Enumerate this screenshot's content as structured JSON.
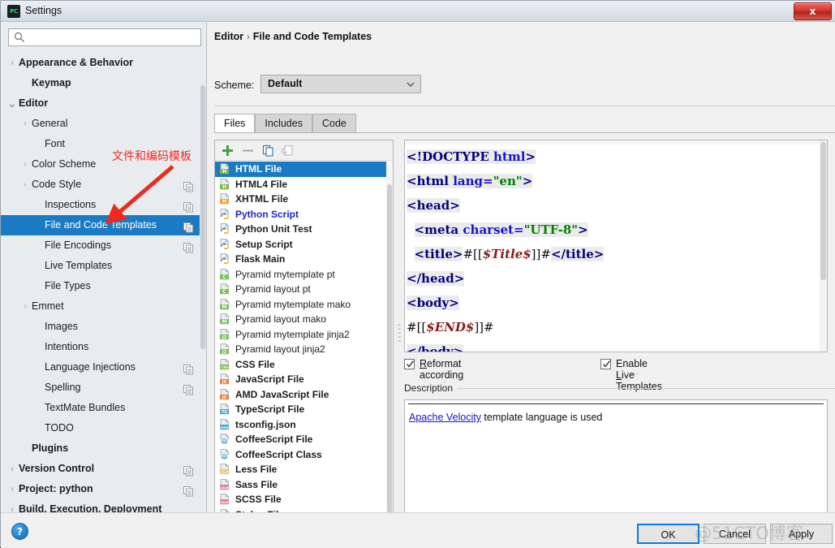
{
  "window": {
    "title": "Settings",
    "app_icon": "pycharm-icon",
    "app_icon_text": "PC",
    "close_label": "x"
  },
  "search": {
    "value": "",
    "placeholder": "",
    "icon": "search-icon"
  },
  "sidebar": {
    "items": [
      {
        "label": "Appearance & Behavior",
        "indent": 0,
        "arrow": "right",
        "bold": true,
        "selected": false,
        "config_icon": false
      },
      {
        "label": "Keymap",
        "indent": 1,
        "arrow": "",
        "bold": true,
        "selected": false,
        "config_icon": false
      },
      {
        "label": "Editor",
        "indent": 0,
        "arrow": "down",
        "bold": true,
        "selected": false,
        "config_icon": false
      },
      {
        "label": "General",
        "indent": 1,
        "arrow": "right",
        "bold": false,
        "selected": false,
        "config_icon": false
      },
      {
        "label": "Font",
        "indent": 2,
        "arrow": "",
        "bold": false,
        "selected": false,
        "config_icon": false
      },
      {
        "label": "Color Scheme",
        "indent": 1,
        "arrow": "right",
        "bold": false,
        "selected": false,
        "config_icon": false
      },
      {
        "label": "Code Style",
        "indent": 1,
        "arrow": "right",
        "bold": false,
        "selected": false,
        "config_icon": true
      },
      {
        "label": "Inspections",
        "indent": 2,
        "arrow": "",
        "bold": false,
        "selected": false,
        "config_icon": true
      },
      {
        "label": "File and Code Templates",
        "indent": 2,
        "arrow": "",
        "bold": false,
        "selected": true,
        "config_icon": true
      },
      {
        "label": "File Encodings",
        "indent": 2,
        "arrow": "",
        "bold": false,
        "selected": false,
        "config_icon": true
      },
      {
        "label": "Live Templates",
        "indent": 2,
        "arrow": "",
        "bold": false,
        "selected": false,
        "config_icon": false
      },
      {
        "label": "File Types",
        "indent": 2,
        "arrow": "",
        "bold": false,
        "selected": false,
        "config_icon": false
      },
      {
        "label": "Emmet",
        "indent": 1,
        "arrow": "right",
        "bold": false,
        "selected": false,
        "config_icon": false
      },
      {
        "label": "Images",
        "indent": 2,
        "arrow": "",
        "bold": false,
        "selected": false,
        "config_icon": false
      },
      {
        "label": "Intentions",
        "indent": 2,
        "arrow": "",
        "bold": false,
        "selected": false,
        "config_icon": false
      },
      {
        "label": "Language Injections",
        "indent": 2,
        "arrow": "",
        "bold": false,
        "selected": false,
        "config_icon": true
      },
      {
        "label": "Spelling",
        "indent": 2,
        "arrow": "",
        "bold": false,
        "selected": false,
        "config_icon": true
      },
      {
        "label": "TextMate Bundles",
        "indent": 2,
        "arrow": "",
        "bold": false,
        "selected": false,
        "config_icon": false
      },
      {
        "label": "TODO",
        "indent": 2,
        "arrow": "",
        "bold": false,
        "selected": false,
        "config_icon": false
      },
      {
        "label": "Plugins",
        "indent": 1,
        "arrow": "",
        "bold": true,
        "selected": false,
        "config_icon": false
      },
      {
        "label": "Version Control",
        "indent": 0,
        "arrow": "right",
        "bold": true,
        "selected": false,
        "config_icon": true
      },
      {
        "label": "Project: python",
        "indent": 0,
        "arrow": "right",
        "bold": true,
        "selected": false,
        "config_icon": true
      },
      {
        "label": "Build, Execution, Deployment",
        "indent": 0,
        "arrow": "right",
        "bold": true,
        "selected": false,
        "config_icon": false
      }
    ]
  },
  "annotation": {
    "text": "文件和编码模板",
    "color": "#ee2a1e"
  },
  "main": {
    "breadcrumb": {
      "parent": "Editor",
      "separator": "›",
      "current": "File and Code Templates"
    },
    "scheme": {
      "label": "Scheme:",
      "value": "Default"
    },
    "tabs": [
      {
        "label": "Files",
        "active": true
      },
      {
        "label": "Includes",
        "active": false
      },
      {
        "label": "Code",
        "active": false
      }
    ],
    "toolbar": [
      {
        "name": "add-template-button",
        "glyph": "plus",
        "enabled": true
      },
      {
        "name": "remove-template-button",
        "glyph": "minus",
        "enabled": false
      },
      {
        "name": "copy-template-button",
        "glyph": "copy",
        "enabled": true
      },
      {
        "name": "reset-template-button",
        "glyph": "reset",
        "enabled": false
      }
    ],
    "templates": [
      {
        "label": "HTML File",
        "icon": "html-file-icon",
        "badge": "H",
        "badge_color": "#7ab648",
        "bold": true,
        "blue": false,
        "selected": true
      },
      {
        "label": "HTML4 File",
        "icon": "html-file-icon",
        "badge": "H",
        "badge_color": "#7ab648",
        "bold": true,
        "blue": false,
        "selected": false
      },
      {
        "label": "XHTML File",
        "icon": "xhtml-file-icon",
        "badge": "H",
        "badge_color": "#f0a030",
        "bold": true,
        "blue": false,
        "selected": false
      },
      {
        "label": "Python Script",
        "icon": "python-file-icon",
        "badge": "PY",
        "badge_color": "#3b77b0",
        "bold": true,
        "blue": true,
        "selected": false
      },
      {
        "label": "Python Unit Test",
        "icon": "python-file-icon",
        "badge": "PY",
        "badge_color": "#3b77b0",
        "bold": true,
        "blue": false,
        "selected": false
      },
      {
        "label": "Setup Script",
        "icon": "python-file-icon",
        "badge": "PY",
        "badge_color": "#3b77b0",
        "bold": true,
        "blue": false,
        "selected": false
      },
      {
        "label": "Flask Main",
        "icon": "python-file-icon",
        "badge": "PY",
        "badge_color": "#3b77b0",
        "bold": true,
        "blue": false,
        "selected": false
      },
      {
        "label": "Pyramid mytemplate pt",
        "icon": "chameleon-file-icon",
        "badge": "C",
        "badge_color": "#79c05a",
        "bold": false,
        "blue": false,
        "selected": false
      },
      {
        "label": "Pyramid layout pt",
        "icon": "chameleon-file-icon",
        "badge": "C",
        "badge_color": "#79c05a",
        "bold": false,
        "blue": false,
        "selected": false
      },
      {
        "label": "Pyramid mytemplate mako",
        "icon": "mako-file-icon",
        "badge": "M",
        "badge_color": "#79c05a",
        "bold": false,
        "blue": false,
        "selected": false
      },
      {
        "label": "Pyramid layout mako",
        "icon": "mako-file-icon",
        "badge": "M",
        "badge_color": "#79c05a",
        "bold": false,
        "blue": false,
        "selected": false
      },
      {
        "label": "Pyramid mytemplate jinja2",
        "icon": "jinja-file-icon",
        "badge": "J2",
        "badge_color": "#79c05a",
        "bold": false,
        "blue": false,
        "selected": false
      },
      {
        "label": "Pyramid layout jinja2",
        "icon": "jinja-file-icon",
        "badge": "J2",
        "badge_color": "#79c05a",
        "bold": false,
        "blue": false,
        "selected": false
      },
      {
        "label": "CSS File",
        "icon": "css-file-icon",
        "badge": "CSS",
        "badge_color": "#7ab648",
        "bold": true,
        "blue": false,
        "selected": false
      },
      {
        "label": "JavaScript File",
        "icon": "js-file-icon",
        "badge": "JS",
        "badge_color": "#f08030",
        "bold": true,
        "blue": false,
        "selected": false
      },
      {
        "label": "AMD JavaScript File",
        "icon": "js-file-icon",
        "badge": "JS",
        "badge_color": "#f08030",
        "bold": true,
        "blue": false,
        "selected": false
      },
      {
        "label": "TypeScript File",
        "icon": "ts-file-icon",
        "badge": "TS",
        "badge_color": "#4fa8d8",
        "bold": true,
        "blue": false,
        "selected": false
      },
      {
        "label": "tsconfig.json",
        "icon": "json-file-icon",
        "badge": "JSON",
        "badge_color": "#4fa8d8",
        "bold": true,
        "blue": false,
        "selected": false
      },
      {
        "label": "CoffeeScript File",
        "icon": "coffee-file-icon",
        "badge": "",
        "badge_color": "#5fb8d8",
        "bold": true,
        "blue": false,
        "selected": false
      },
      {
        "label": "CoffeeScript Class",
        "icon": "coffee-file-icon",
        "badge": "",
        "badge_color": "#5fb8d8",
        "bold": true,
        "blue": false,
        "selected": false
      },
      {
        "label": "Less File",
        "icon": "less-file-icon",
        "badge": "{L}",
        "badge_color": "#efc07a",
        "bold": true,
        "blue": false,
        "selected": false
      },
      {
        "label": "Sass File",
        "icon": "sass-file-icon",
        "badge": "SASS",
        "badge_color": "#e08090",
        "bold": true,
        "blue": false,
        "selected": false
      },
      {
        "label": "SCSS File",
        "icon": "scss-file-icon",
        "badge": "SASS",
        "badge_color": "#e08090",
        "bold": true,
        "blue": false,
        "selected": false
      },
      {
        "label": "Stylus File",
        "icon": "stylus-file-icon",
        "badge": "ST",
        "badge_color": "#9fc05a",
        "bold": true,
        "blue": false,
        "selected": false
      }
    ],
    "editor": {
      "lines": [
        [
          {
            "t": "<!DOCTYPE ",
            "c": "tag",
            "hl": true
          },
          {
            "t": "html",
            "c": "attr",
            "hl": true
          },
          {
            "t": ">",
            "c": "tag",
            "hl": true
          }
        ],
        [
          {
            "t": "<html ",
            "c": "tag",
            "hl": true
          },
          {
            "t": "lang=",
            "c": "attr",
            "hl": true
          },
          {
            "t": "\"en\"",
            "c": "val",
            "hl": true
          },
          {
            "t": ">",
            "c": "tag",
            "hl": true
          }
        ],
        [
          {
            "t": "<head>",
            "c": "tag",
            "hl": true
          }
        ],
        [
          {
            "t": "  ",
            "c": "plain",
            "hl": false
          },
          {
            "t": "<meta ",
            "c": "tag",
            "hl": true
          },
          {
            "t": "charset=",
            "c": "attr",
            "hl": true
          },
          {
            "t": "\"UTF-8\"",
            "c": "val",
            "hl": true
          },
          {
            "t": ">",
            "c": "tag",
            "hl": true
          }
        ],
        [
          {
            "t": "  ",
            "c": "plain",
            "hl": false
          },
          {
            "t": "<title>",
            "c": "tag",
            "hl": true
          },
          {
            "t": "#[[",
            "c": "plain",
            "hl": false
          },
          {
            "t": "$Title$",
            "c": "var",
            "hl": false
          },
          {
            "t": "]]#",
            "c": "plain",
            "hl": false
          },
          {
            "t": "</title>",
            "c": "tag",
            "hl": true
          }
        ],
        [
          {
            "t": "</head>",
            "c": "tag",
            "hl": true
          }
        ],
        [
          {
            "t": "<body>",
            "c": "tag",
            "hl": true
          }
        ],
        [
          {
            "t": "#[[",
            "c": "plain",
            "hl": false
          },
          {
            "t": "$END$",
            "c": "var",
            "hl": false
          },
          {
            "t": "]]#",
            "c": "plain",
            "hl": false
          }
        ],
        [
          {
            "t": "</body>",
            "c": "tag",
            "hl": true
          }
        ]
      ]
    },
    "options": [
      {
        "label_pre": "",
        "mnemonic": "R",
        "label_post": "eformat according to style",
        "checked": true,
        "name": "reformat-checkbox"
      },
      {
        "label_pre": "Enable ",
        "mnemonic": "L",
        "label_post": "ive Templates",
        "checked": true,
        "name": "live-templates-checkbox"
      }
    ],
    "description": {
      "title": "Description",
      "link_text": "Apache Velocity",
      "rest_text": " template language is used"
    }
  },
  "footer": {
    "help": "?",
    "buttons": [
      {
        "label": "OK",
        "name": "ok-button",
        "primary": true
      },
      {
        "label": "Cancel",
        "name": "cancel-button",
        "primary": false
      },
      {
        "label": "Apply",
        "name": "apply-button",
        "primary": false
      }
    ]
  },
  "watermark": {
    "text": "@51CTO博客"
  }
}
